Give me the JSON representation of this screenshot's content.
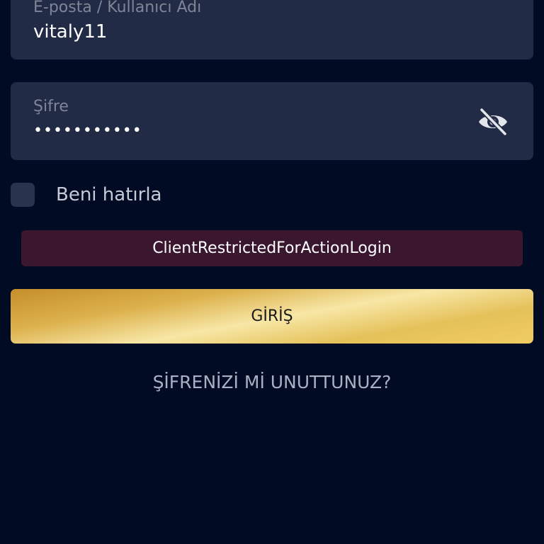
{
  "login_form": {
    "username": {
      "label": "E-posta / Kullanıcı Adı",
      "value": "vitaly11"
    },
    "password": {
      "label": "Şifre",
      "masked_value": "•••••••••••",
      "toggle_icon": "eye-off-icon"
    },
    "remember_me": {
      "label": "Beni hatırla",
      "checked": false
    },
    "error_message": "ClientRestrictedForActionLogin",
    "submit_label": "GİRİŞ",
    "forgot_password_label": "ŞİFRENİZİ Mİ UNUTTUNUZ?"
  },
  "colors": {
    "background": "#020b24",
    "field_background": "#222b45",
    "error_background": "#3a172f",
    "button_gold": "#e5c15a"
  }
}
